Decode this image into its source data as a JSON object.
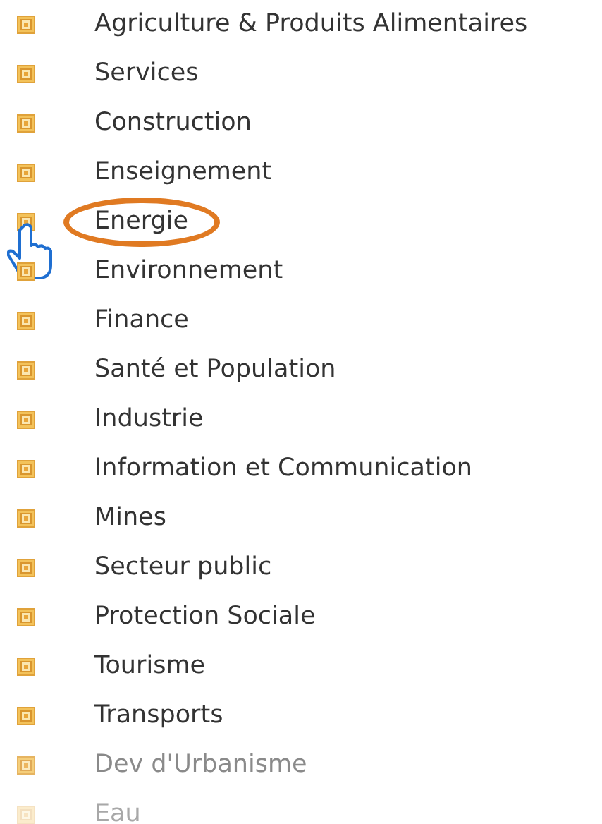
{
  "items": [
    {
      "label": "Agriculture & Produits Alimentaires",
      "selected": false,
      "kind": "normal"
    },
    {
      "label": "Services",
      "selected": false,
      "kind": "normal"
    },
    {
      "label": "Construction",
      "selected": false,
      "kind": "normal"
    },
    {
      "label": "Enseignement",
      "selected": false,
      "kind": "normal"
    },
    {
      "label": "Energie",
      "selected": true,
      "kind": "normal"
    },
    {
      "label": "Environnement",
      "selected": false,
      "kind": "normal"
    },
    {
      "label": "Finance",
      "selected": false,
      "kind": "normal"
    },
    {
      "label": "Santé et Population",
      "selected": false,
      "kind": "normal"
    },
    {
      "label": "Industrie",
      "selected": false,
      "kind": "normal"
    },
    {
      "label": "Information et Communication",
      "selected": false,
      "kind": "normal"
    },
    {
      "label": "Mines",
      "selected": false,
      "kind": "normal"
    },
    {
      "label": "Secteur public",
      "selected": false,
      "kind": "normal"
    },
    {
      "label": "Protection Sociale",
      "selected": false,
      "kind": "normal"
    },
    {
      "label": "Tourisme",
      "selected": false,
      "kind": "normal"
    },
    {
      "label": "Transports",
      "selected": false,
      "kind": "normal"
    },
    {
      "label": "Dev d'Urbanisme",
      "selected": false,
      "kind": "faded"
    },
    {
      "label": "Eau",
      "selected": false,
      "kind": "faint"
    }
  ]
}
